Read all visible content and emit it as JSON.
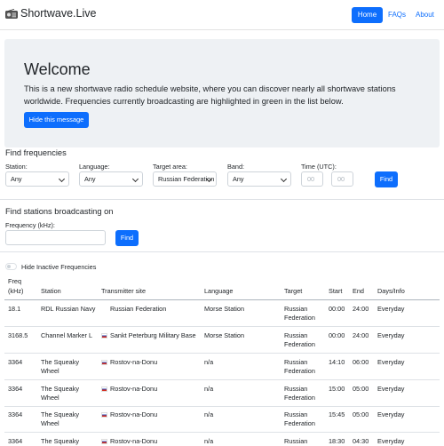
{
  "nav": {
    "brand": "Shortwave.Live",
    "home": "Home",
    "faqs": "FAQs",
    "about": "About"
  },
  "welcome": {
    "title": "Welcome",
    "text": "This is a new shortwave radio schedule website, where you can discover nearly all shortwave stations worldwide. Frequencies currently broadcasting are highlighted in green in the list below.",
    "hide_button": "Hide this message"
  },
  "find_freq": {
    "title": "Find frequencies",
    "station_label": "Station:",
    "station_value": "Any",
    "language_label": "Language:",
    "language_value": "Any",
    "target_label": "Target area:",
    "target_value": "Russian Federation",
    "band_label": "Band:",
    "band_value": "Any",
    "time_label": "Time (UTC):",
    "time_hh_placeholder": "00",
    "time_mm_placeholder": "00",
    "find_button": "Find"
  },
  "find_stations": {
    "title": "Find stations broadcasting on",
    "freq_label": "Frequency (kHz):",
    "find_button": "Find"
  },
  "toggle_label": "Hide Inactive Frequencies",
  "table": {
    "headers": {
      "freq": "Freq",
      "freq_unit": "(kHz)",
      "station": "Station",
      "site": "Transmitter site",
      "language": "Language",
      "target": "Target",
      "start": "Start",
      "end": "End",
      "days": "Days/Info"
    },
    "rows": [
      {
        "freq": "18.1",
        "station": "RDL Russian Navy",
        "station2": "",
        "site": "Russian Federation",
        "language": "Morse Station",
        "target": "Russian",
        "target2": "Federation",
        "start": "00:00",
        "end": "24:00",
        "days": "Everyday"
      },
      {
        "freq": "3168.5",
        "station": "Channel Marker L",
        "station2": "",
        "site": "Sankt Peterburg Military Base",
        "language": "Morse Station",
        "target": "Russian",
        "target2": "Federation",
        "start": "00:00",
        "end": "24:00",
        "days": "Everyday"
      },
      {
        "freq": "3364",
        "station": "The Squeaky",
        "station2": "Wheel",
        "site": "Rostov-na-Donu",
        "language": "n/a",
        "target": "Russian",
        "target2": "Federation",
        "start": "14:10",
        "end": "06:00",
        "days": "Everyday"
      },
      {
        "freq": "3364",
        "station": "The Squeaky",
        "station2": "Wheel",
        "site": "Rostov-na-Donu",
        "language": "n/a",
        "target": "Russian",
        "target2": "Federation",
        "start": "15:00",
        "end": "05:00",
        "days": "Everyday"
      },
      {
        "freq": "3364",
        "station": "The Squeaky",
        "station2": "Wheel",
        "site": "Rostov-na-Donu",
        "language": "n/a",
        "target": "Russian",
        "target2": "Federation",
        "start": "15:45",
        "end": "05:00",
        "days": "Everyday"
      },
      {
        "freq": "3364",
        "station": "The Squeaky",
        "station2": "",
        "site": "Rostov-na-Donu",
        "language": "n/a",
        "target": "Russian",
        "target2": "",
        "start": "18:30",
        "end": "04:30",
        "days": "Everyday"
      }
    ]
  },
  "colors": {
    "accent": "#0d6efd",
    "jumbotron": "#eef1f4"
  }
}
